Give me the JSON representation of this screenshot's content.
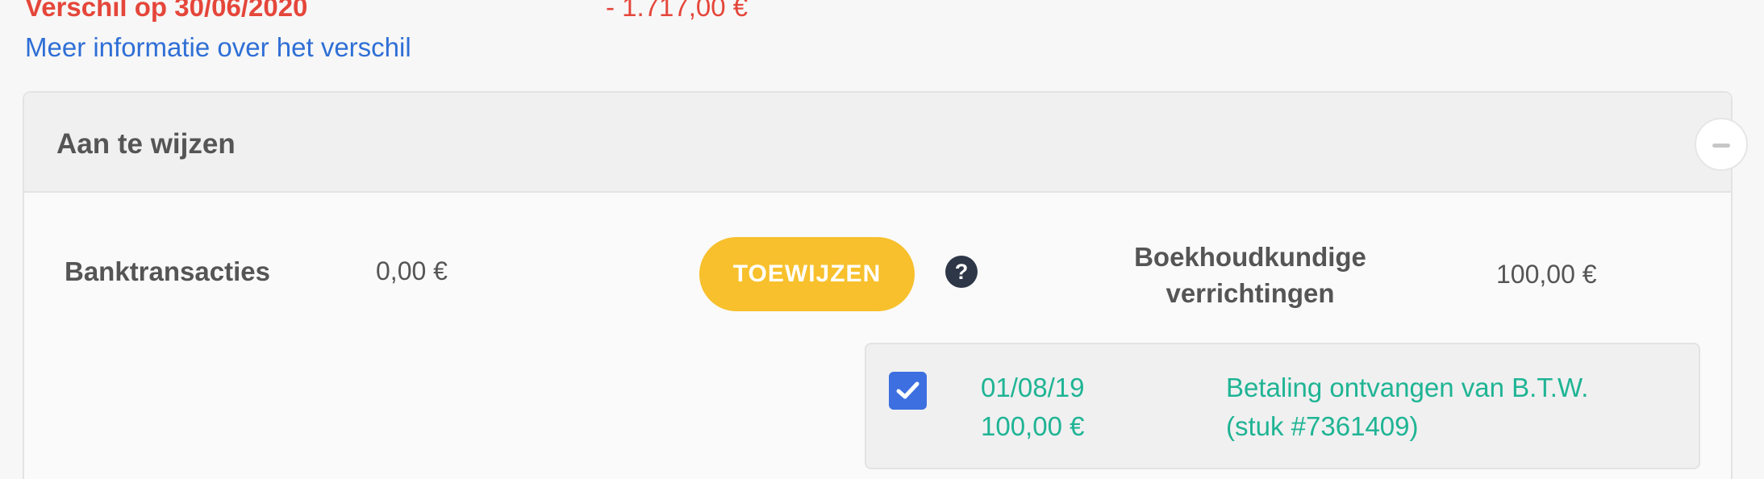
{
  "summary": {
    "difference_label": "Verschil op 30/06/2020",
    "difference_value": "- 1.717,00 €",
    "more_info_link": "Meer informatie over het verschil"
  },
  "section": {
    "title": "Aan te wijzen",
    "collapse_icon": "minus-icon"
  },
  "bank": {
    "label": "Banktransacties",
    "value": "0,00 €"
  },
  "assign_button": {
    "label": "TOEWIJZEN"
  },
  "help": {
    "icon": "question-circle-icon",
    "glyph": "?"
  },
  "accounting": {
    "label": "Boekhoudkundige verrichtingen",
    "value": "100,00 €"
  },
  "transactions": [
    {
      "checked": true,
      "date": "01/08/19",
      "amount": "100,00 €",
      "description": "Betaling ontvangen van B.T.W.",
      "document": "(stuk #7361409)"
    }
  ],
  "colors": {
    "negative": "#e5463a",
    "link": "#2f6fd6",
    "accent_button": "#f7c02c",
    "success_text": "#1fb494",
    "checkbox": "#3d6fe0"
  }
}
